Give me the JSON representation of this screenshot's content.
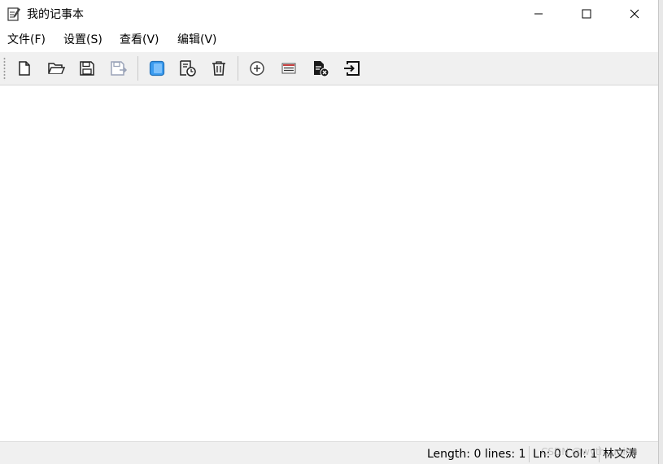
{
  "window": {
    "title": "我的记事本",
    "controls": [
      "minimize",
      "maximize",
      "close"
    ]
  },
  "menubar": {
    "items": [
      {
        "label": "文件(F)"
      },
      {
        "label": "设置(S)"
      },
      {
        "label": "查看(V)"
      },
      {
        "label": "编辑(V)"
      }
    ]
  },
  "toolbar": {
    "buttons": [
      {
        "icon": "new-file-icon"
      },
      {
        "icon": "open-folder-icon"
      },
      {
        "icon": "save-icon"
      },
      {
        "icon": "save-as-icon",
        "enabled": false
      },
      {
        "icon": "sidebar-toggle-icon",
        "active": true
      },
      {
        "icon": "document-history-icon"
      },
      {
        "icon": "trash-icon"
      },
      {
        "icon": "add-circle-icon"
      },
      {
        "icon": "list-view-icon"
      },
      {
        "icon": "file-delete-icon"
      },
      {
        "icon": "exit-icon"
      }
    ]
  },
  "editor": {
    "content": ""
  },
  "statusbar": {
    "length_lines": "Length: 0 lines: 1",
    "position": "Ln: 0 Col: 1",
    "author": "林文涛"
  },
  "watermark": "CSDN @wyth_ugin9",
  "colors": {
    "accent": "#3b9cf0",
    "toolbar_bg": "#f0f0f0",
    "statusbar_bg": "#f0f0f0"
  }
}
